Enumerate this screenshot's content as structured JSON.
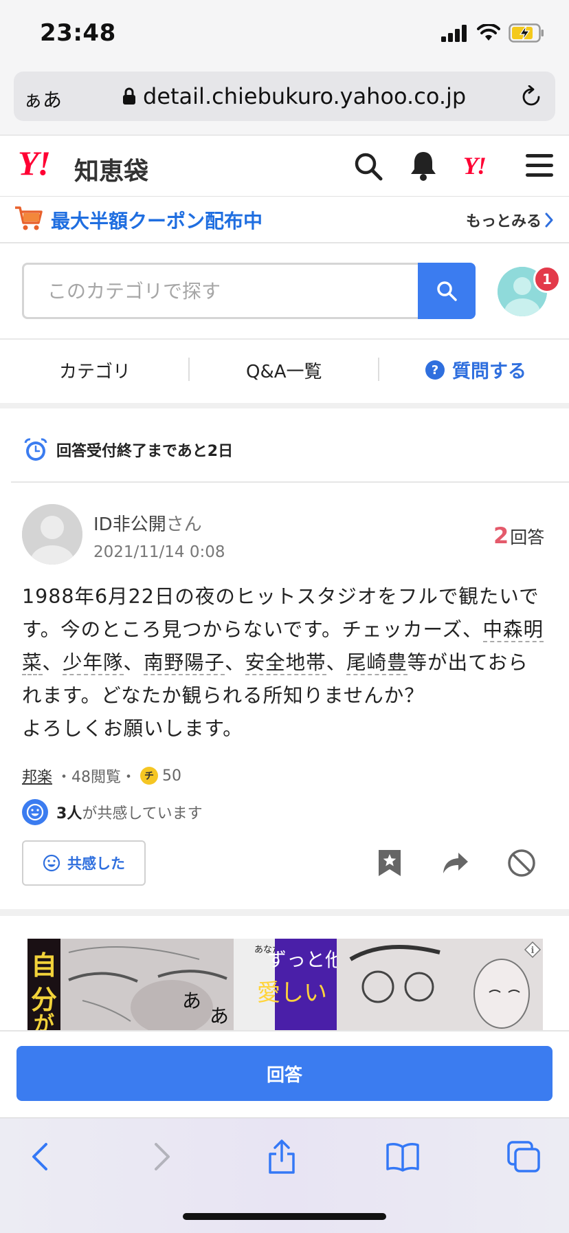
{
  "status_bar": {
    "time": "23:48"
  },
  "browser": {
    "aa_label": "ぁあ",
    "url": "detail.chiebukuro.yahoo.co.jp"
  },
  "header": {
    "logo": "Y!",
    "service_name": "知恵袋"
  },
  "coupon": {
    "text": "最大半額クーポン配布中",
    "more": "もっとみる"
  },
  "search": {
    "placeholder": "このカテゴリで探す"
  },
  "notification_badge": "1",
  "nav": {
    "tabs": [
      {
        "label": "カテゴリ"
      },
      {
        "label": "Q&A一覧"
      },
      {
        "label": "質問する"
      }
    ]
  },
  "deadline": "回答受付終了まであと2日",
  "question": {
    "user": "ID非公開",
    "user_suffix": "さん",
    "date": "2021/11/14 0:08",
    "answer_count": "2",
    "answer_label": "回答",
    "body": {
      "p1": "1988年6月22日の夜のヒットスタジオをフルで観たいです。今のところ見つからないです。チェッカーズ、",
      "kw1": "中森明菜",
      "sep1": "、",
      "kw2": "少年隊",
      "sep2": "、",
      "kw3": "南野陽子",
      "sep3": "、",
      "kw4": "安全地帯",
      "sep4": "、",
      "kw5": "尾崎豊",
      "p2": "等が出ておられます。どなたか観られる所知りませんか？",
      "p3": "よろしくお願いします。"
    },
    "category": "邦楽",
    "views": "・48閲覧・",
    "coin_mark": "チ",
    "coins": "50",
    "empathy_count": "3人",
    "empathy_text": "が共感しています",
    "empathy_button": "共感した"
  },
  "answer_button": "回答",
  "colors": {
    "accent": "#3b7cf0",
    "brand_red": "#ff0033",
    "badge_red": "#e33a4a",
    "answer_count_red": "#e45a6b"
  }
}
